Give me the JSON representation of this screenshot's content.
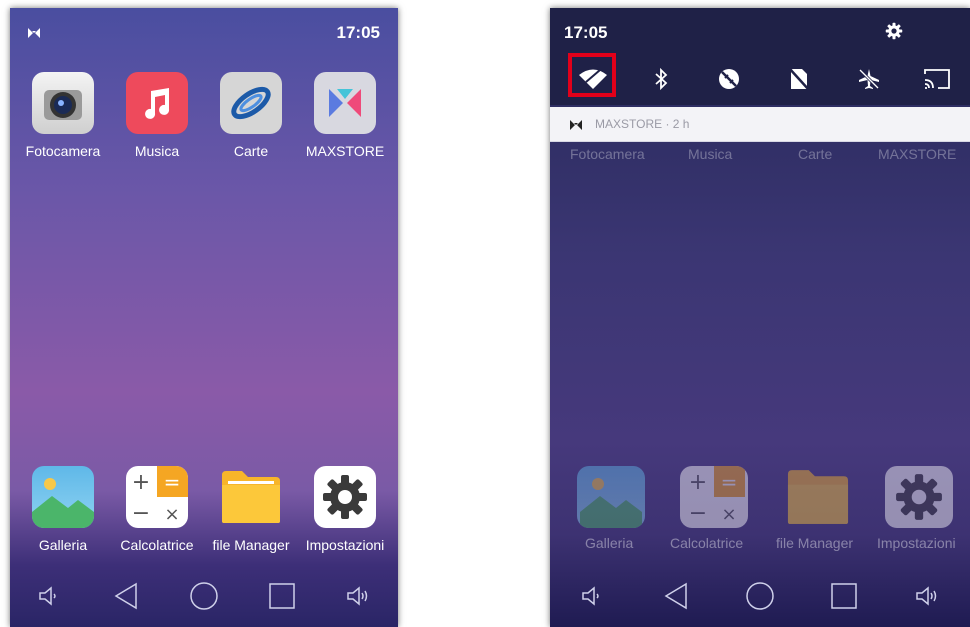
{
  "left_screen": {
    "status_time": "17:05",
    "apps_top": [
      {
        "label": "Fotocamera",
        "icon": "camera-icon"
      },
      {
        "label": "Musica",
        "icon": "music-note-icon"
      },
      {
        "label": "Carte",
        "icon": "maps-icon"
      },
      {
        "label": "MAXSTORE",
        "icon": "maxstore-icon"
      }
    ],
    "apps_dock": [
      {
        "label": "Galleria",
        "icon": "gallery-icon"
      },
      {
        "label": "Calcolatrice",
        "icon": "calculator-icon"
      },
      {
        "label": "file Manager",
        "icon": "folder-icon"
      },
      {
        "label": "Impostazioni",
        "icon": "settings-gear-icon"
      }
    ]
  },
  "right_screen": {
    "status_time": "17:05",
    "quick_settings": [
      "wifi-icon",
      "bluetooth-icon",
      "data-off-icon",
      "no-sim-icon",
      "airplane-mode-icon",
      "cast-icon"
    ],
    "highlighted_tile": "wifi-icon",
    "notification": {
      "text": "MAXSTORE · 2 h"
    },
    "dim_app_labels": [
      "Fotocamera",
      "Musica",
      "Carte",
      "MAXSTORE"
    ],
    "dim_dock_labels": [
      "Galleria",
      "Calcolatrice",
      "file Manager",
      "Impostazioni"
    ]
  },
  "navbar": [
    "volume-down-icon",
    "back-icon",
    "home-icon",
    "recents-icon",
    "volume-up-icon"
  ],
  "colors": {
    "highlight": "#e2001a",
    "header_bg": "#1f2147"
  }
}
